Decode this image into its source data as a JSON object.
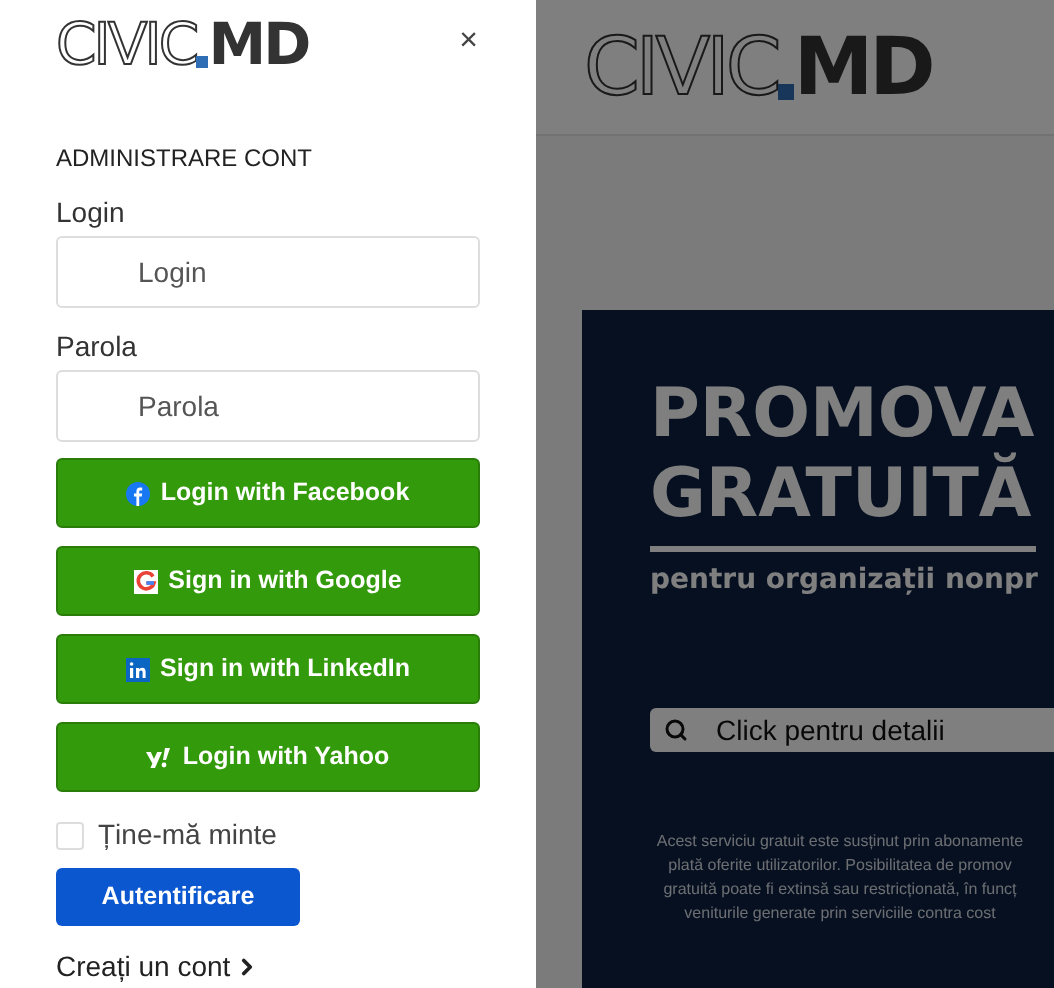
{
  "drawer": {
    "logo": {
      "outline": "CIVIC",
      "bold": "MD"
    },
    "close": "×",
    "heading": "ADMINISTRARE CONT",
    "fields": [
      {
        "label": "Login",
        "placeholder": "Login"
      },
      {
        "label": "Parola",
        "placeholder": "Parola"
      }
    ],
    "social_buttons": [
      {
        "kind": "facebook",
        "label": "Login with Facebook"
      },
      {
        "kind": "google",
        "label": "Sign in with Google"
      },
      {
        "kind": "linkedin",
        "label": "Sign in with LinkedIn"
      },
      {
        "kind": "yahoo",
        "label": "Login with Yahoo"
      }
    ],
    "remember": {
      "label": "Ține-mă minte",
      "checked": false
    },
    "submit": "Autentificare",
    "create_account": "Creați un cont"
  },
  "page": {
    "logo": {
      "outline": "CIVIC",
      "bold": "MD"
    },
    "banner": {
      "title_lines": [
        "PROMOVA",
        "GRATUITĂ"
      ],
      "subtitle": "pentru organizații nonpr",
      "search": "Click pentru detalii",
      "note_lines": [
        "Acest serviciu gratuit este susținut prin abonamente",
        "plată oferite utilizatorilor. Posibilitatea de promov",
        "gratuită poate fi extinsă sau restricționată, în funcț",
        "veniturile generate prin serviciile contra cost"
      ]
    }
  }
}
